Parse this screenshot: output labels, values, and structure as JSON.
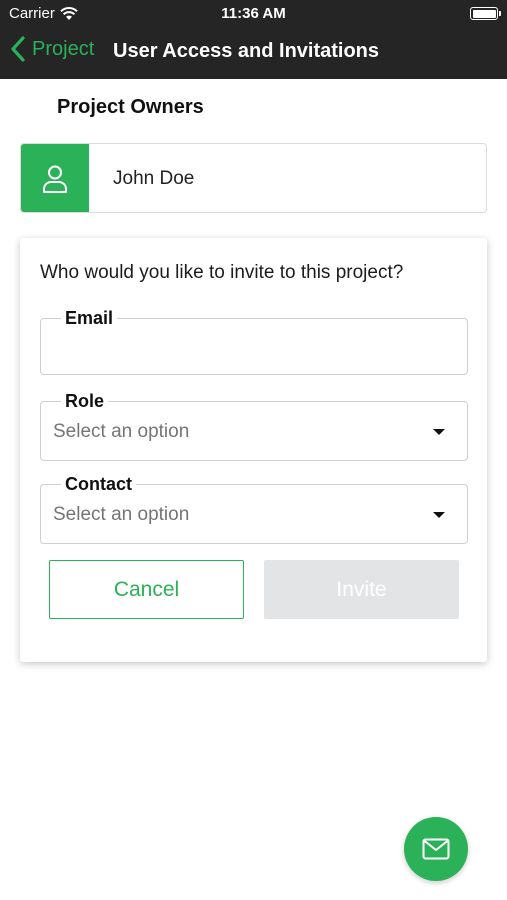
{
  "status_bar": {
    "carrier": "Carrier",
    "time": "11:36 AM"
  },
  "nav": {
    "back_label": "Project",
    "title": "User Access and Invitations"
  },
  "owners": {
    "section_title": "Project Owners",
    "items": [
      {
        "name": "John Doe",
        "icon": "user-icon"
      }
    ]
  },
  "invite": {
    "question": "Who would you like to invite to this project?",
    "email": {
      "label": "Email",
      "value": "",
      "placeholder": ""
    },
    "role": {
      "label": "Role",
      "value": "Select an option"
    },
    "contact": {
      "label": "Contact",
      "value": "Select an option"
    },
    "cancel_label": "Cancel",
    "invite_label": "Invite"
  },
  "fab": {
    "icon": "mail-icon"
  },
  "colors": {
    "accent": "#2bb157",
    "topbar": "#252526",
    "disabled_button": "#e2e4e5"
  }
}
